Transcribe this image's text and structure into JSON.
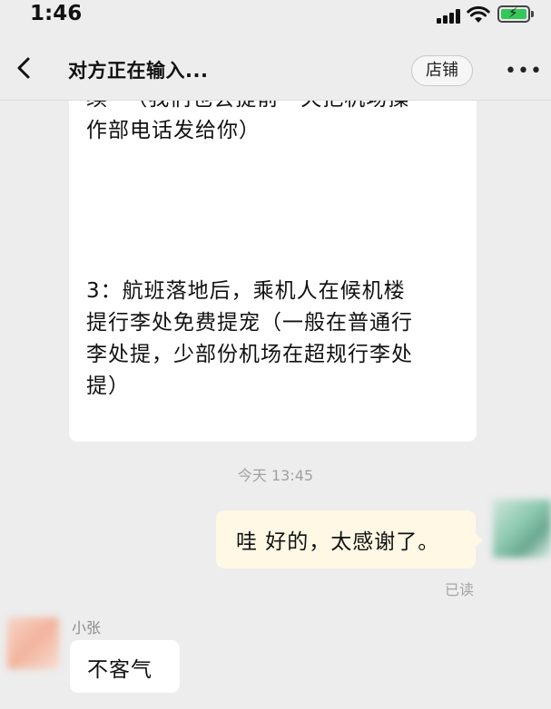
{
  "status_bar": {
    "time": "1:46"
  },
  "header": {
    "title": "对方正在输入...",
    "shop_button": "店铺"
  },
  "messages": {
    "received_lines_top": "续~（我们也会提前一天把机场操\n作部电话发给你）",
    "received_lines_bottom": "3：航班落地后，乘机人在候机楼\n提行李处免费提宠（一般在普通行\n李处提，少部份机场在超规行李处\n提）",
    "timestamp": "今天 13:45",
    "sent_text": "哇 好的，太感谢了。",
    "read_status": "已读",
    "sender_name": "小张",
    "reply_text": "不客气"
  },
  "colors": {
    "background": "#ededed",
    "bubble_received": "#ffffff",
    "bubble_sent": "#fef8e4",
    "battery_green": "#34c759"
  },
  "icons": [
    "back-icon",
    "more-icon",
    "signal-icon",
    "wifi-icon",
    "battery-icon"
  ]
}
